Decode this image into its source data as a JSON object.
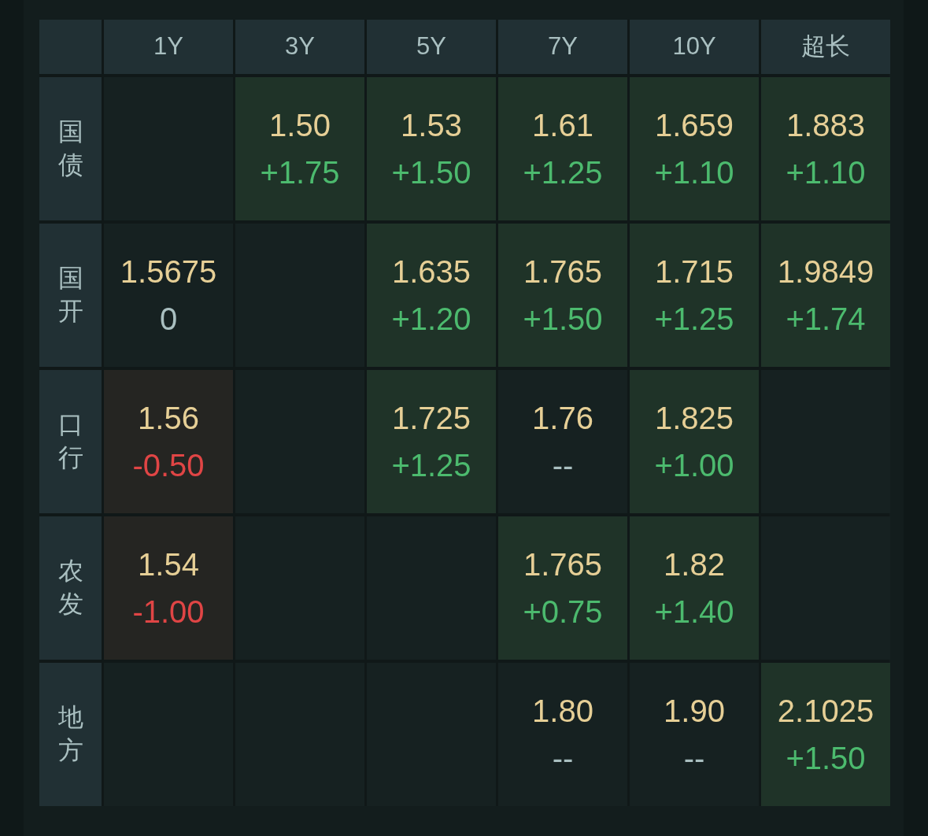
{
  "table": {
    "columns": [
      "1Y",
      "3Y",
      "5Y",
      "7Y",
      "10Y",
      "超长"
    ],
    "rows": [
      {
        "label": "国债",
        "cells": [
          null,
          {
            "yield": "1.50",
            "change": "+1.75",
            "kind": "up"
          },
          {
            "yield": "1.53",
            "change": "+1.50",
            "kind": "up"
          },
          {
            "yield": "1.61",
            "change": "+1.25",
            "kind": "up"
          },
          {
            "yield": "1.659",
            "change": "+1.10",
            "kind": "up"
          },
          {
            "yield": "1.883",
            "change": "+1.10",
            "kind": "up"
          }
        ]
      },
      {
        "label": "国开",
        "cells": [
          {
            "yield": "1.5675",
            "change": "0",
            "kind": "flat"
          },
          null,
          {
            "yield": "1.635",
            "change": "+1.20",
            "kind": "up"
          },
          {
            "yield": "1.765",
            "change": "+1.50",
            "kind": "up"
          },
          {
            "yield": "1.715",
            "change": "+1.25",
            "kind": "up"
          },
          {
            "yield": "1.9849",
            "change": "+1.74",
            "kind": "up"
          }
        ]
      },
      {
        "label": "口行",
        "cells": [
          {
            "yield": "1.56",
            "change": "-0.50",
            "kind": "down"
          },
          null,
          {
            "yield": "1.725",
            "change": "+1.25",
            "kind": "up"
          },
          {
            "yield": "1.76",
            "change": "--",
            "kind": "flat"
          },
          {
            "yield": "1.825",
            "change": "+1.00",
            "kind": "up"
          },
          null
        ]
      },
      {
        "label": "农发",
        "cells": [
          {
            "yield": "1.54",
            "change": "-1.00",
            "kind": "down"
          },
          null,
          null,
          {
            "yield": "1.765",
            "change": "+0.75",
            "kind": "up"
          },
          {
            "yield": "1.82",
            "change": "+1.40",
            "kind": "up"
          },
          null
        ]
      },
      {
        "label": "地方",
        "cells": [
          null,
          null,
          null,
          {
            "yield": "1.80",
            "change": "--",
            "kind": "flat"
          },
          {
            "yield": "1.90",
            "change": "--",
            "kind": "flat"
          },
          {
            "yield": "2.1025",
            "change": "+1.50",
            "kind": "up"
          }
        ]
      }
    ]
  }
}
